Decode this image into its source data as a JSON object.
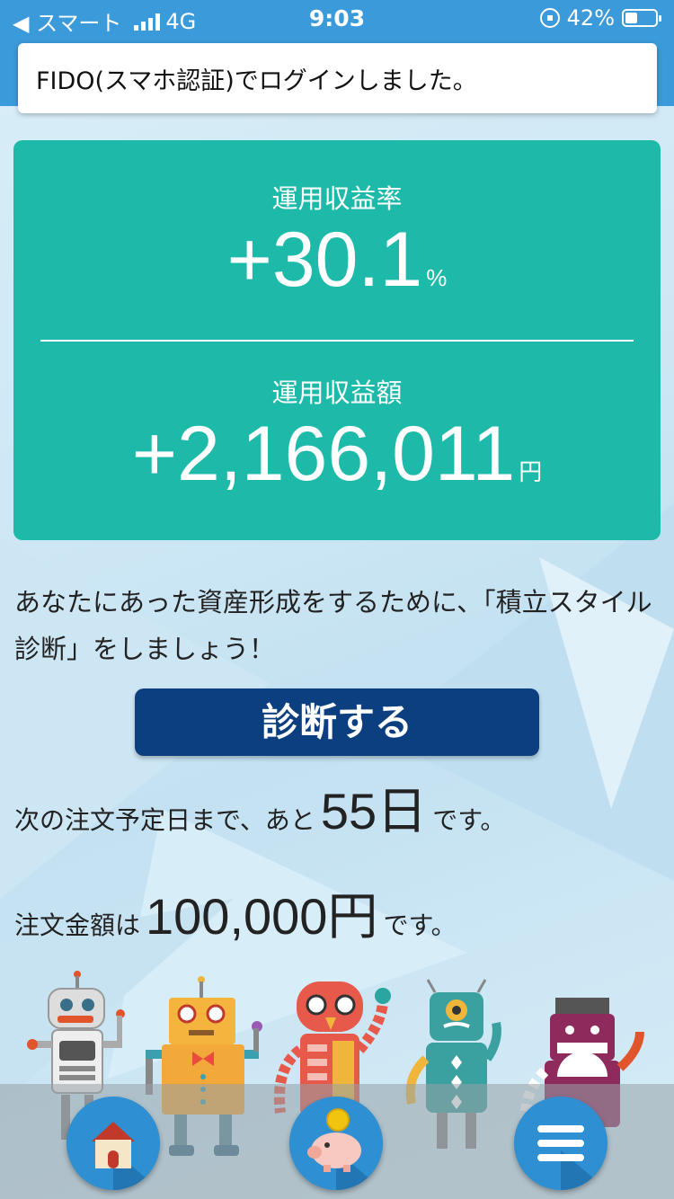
{
  "status_bar": {
    "back_label": "◀ スマート",
    "network": "4G",
    "time": "9:03",
    "battery": "42%",
    "battery_level": 0.42
  },
  "toast": {
    "message": "FIDO(スマホ認証)でログインしました。"
  },
  "stats": {
    "return_rate_label": "運用収益率",
    "return_rate_value": "+30.1",
    "return_rate_unit": "%",
    "return_amount_label": "運用収益額",
    "return_amount_value": "+2,166,011",
    "return_amount_unit": "円"
  },
  "intro_text": "あなたにあった資産形成をするために、「積立スタイル診断」をしましょう！",
  "diagnose_button": "診断する",
  "next_order": {
    "prefix": "次の注文予定日まで、あと",
    "days": "55",
    "days_unit": "日",
    "suffix": "です。"
  },
  "order_amount": {
    "prefix": "注文金額は",
    "amount": "100,000",
    "unit": "円",
    "suffix": "です。"
  },
  "bottom_nav": {
    "items": [
      "home-icon",
      "piggy-bank-icon",
      "menu-icon"
    ]
  },
  "colors": {
    "header": "#3b9ad9",
    "card": "#1dbaa9",
    "button": "#0c3f80",
    "nav_button": "#2f8fd3"
  }
}
